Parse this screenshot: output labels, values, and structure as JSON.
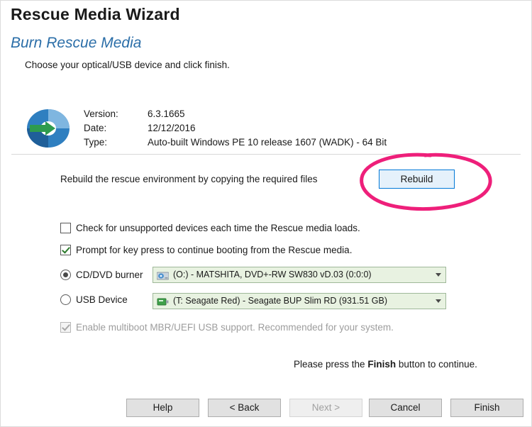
{
  "window": {
    "title": "Rescue Media Wizard",
    "subtitle": "Burn Rescue Media",
    "instruction": "Choose your optical/USB device and click finish."
  },
  "info": {
    "rows": [
      {
        "label": "Version:",
        "value": "6.3.1665"
      },
      {
        "label": "Date:",
        "value": "12/12/2016"
      },
      {
        "label": "Type:",
        "value": "Auto-built Windows PE 10 release 1607 (WADK) - 64 Bit"
      }
    ]
  },
  "rebuild": {
    "description": "Rebuild the rescue environment by copying the required files",
    "button_label": "Rebuild"
  },
  "options": {
    "unsupported_devices": {
      "label": "Check for unsupported devices each time the Rescue media loads.",
      "checked": false
    },
    "key_press": {
      "label": "Prompt for key press to continue booting from the Rescue media.",
      "checked": true
    },
    "multiboot": {
      "label": "Enable multiboot MBR/UEFI USB support. Recommended for your system.",
      "checked": true,
      "disabled": true
    }
  },
  "devices": {
    "cd_radio_label": "CD/DVD burner",
    "cd_selected": true,
    "cd_combo_value": "(O:) - MATSHITA, DVD+-RW SW830   vD.03 (0:0:0)",
    "usb_radio_label": "USB Device",
    "usb_selected": false,
    "usb_combo_value": "(T: Seagate Red) - Seagate BUP Slim RD (931.51 GB)"
  },
  "footer": {
    "note_prefix": "Please press the",
    "note_bold": "Finish",
    "note_suffix": "button to continue.",
    "buttons": [
      {
        "label": "Help",
        "disabled": false
      },
      {
        "label": "< Back",
        "disabled": false
      },
      {
        "label": "Next >",
        "disabled": true
      },
      {
        "label": "Cancel",
        "disabled": false
      },
      {
        "label": "Finish",
        "disabled": false
      }
    ]
  },
  "annotation": {
    "color": "#ee1f7a",
    "shape": "hand-drawn-ellipse-around-rebuild-button"
  },
  "icons": {
    "disc": "rescue-disc-icon",
    "optical_drive": "optical-drive-icon",
    "usb_drive": "usb-drive-icon",
    "dropdown": "chevron-down-icon"
  }
}
